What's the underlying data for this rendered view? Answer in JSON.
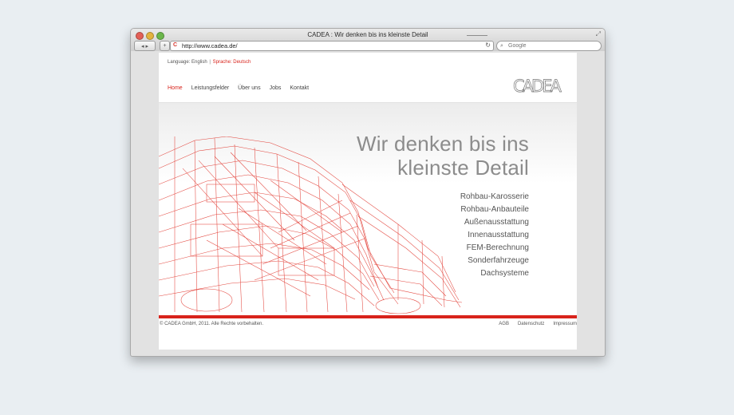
{
  "browser": {
    "window_title": "CADEA : Wir denken bis ins kleinste Detail",
    "url": "http://www.cadea.de/",
    "search_placeholder": "Google",
    "back_forward_label": "◂ ▸",
    "add_label": "+",
    "reload_icon": "↻",
    "search_icon": "⌕",
    "favicon": "C",
    "fullscreen_icon": "⤢"
  },
  "header": {
    "language_label": "Language: English",
    "language_separator": "|",
    "language_active": "Sprache: Deutsch",
    "logo_text": "CADEA"
  },
  "nav": [
    "Home",
    "Leistungsfelder",
    "Über uns",
    "Jobs",
    "Kontakt"
  ],
  "hero": {
    "headline_line1": "Wir denken bis ins",
    "headline_line2": "kleinste Detail",
    "services": [
      "Rohbau-Karosserie",
      "Rohbau-Anbauteile",
      "Außenausstattung",
      "Innenausstattung",
      "FEM-Berechnung",
      "Sonderfahrzeuge",
      "Dachsysteme"
    ]
  },
  "footer": {
    "copyright": "© CADEA GmbH, 2011. Alle Rechte vorbehalten.",
    "links": [
      "AGB",
      "Datenschutz",
      "Impressum"
    ]
  },
  "colors": {
    "accent_red": "#d8231b",
    "text_gray": "#555555",
    "headline_gray": "#8c8c8c",
    "background": "#e9eef2"
  }
}
